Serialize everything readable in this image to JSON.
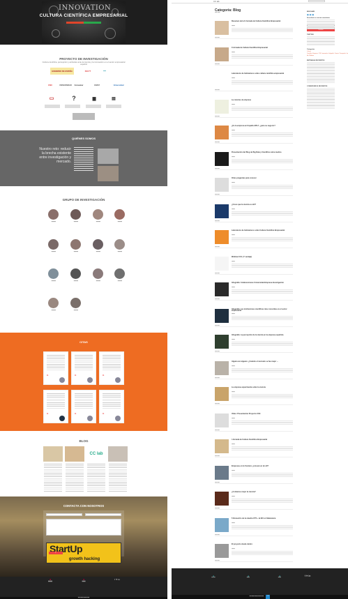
{
  "left": {
    "hero": {
      "title": "CULTURA CIENTÍFICA EMPRESARIAL",
      "innovation_word": "INNOVATION"
    },
    "project": {
      "title": "PROYECTO DE INVESTIGACIÓN",
      "subtitle": "Cultura científica, percepción y actitudes ante la ciencia y la innovación en el sector empresarial español",
      "logos": [
        "GOBIERNO DE ESPAÑA",
        "FECYT",
        "CSIC",
        "UNIVERSIDAD",
        "Consumer",
        "ICMAT",
        "Universidad"
      ],
      "icons": [
        "book-icon",
        "question-icon",
        "group-icon",
        "chart-icon"
      ]
    },
    "quienes": {
      "title": "QUIÉNES SOMOS",
      "quote": "Nuestro reto: reducir la brecha existente entre investigación y mercado."
    },
    "grupo": {
      "title": "GRUPO DE INVESTIGACIÓN"
    },
    "citas": {
      "title": "CITAS"
    },
    "blog": {
      "title": "BLOG",
      "cc_logo": "CC lab"
    },
    "contact": {
      "title": "CONTACTA CON NOSOTROS",
      "startup_word": "StartUp",
      "growth_word": "growth hacking"
    },
    "footer": {
      "social": "f ✈ in"
    }
  },
  "right": {
    "topnav": {
      "logo": "CC lab"
    },
    "category_title": "Categoría: Blog",
    "posts": [
      {
        "title": "Resumen de la II Jornada de Cultura Científica Empresarial"
      },
      {
        "title": "II Jornada de Cultura Científica Empresarial"
      },
      {
        "title": "Laboratorio de Indicadores sobre cultura científica empresarial"
      },
      {
        "title": "La ciencia a la empresa"
      },
      {
        "title": "¿Es la empresa en España APIs?, ¿para su negocio?"
      },
      {
        "title": "Presentación del Blog de Big Data y Científica sobre medios"
      },
      {
        "title": "Otras preguntas para conocer"
      },
      {
        "title": "¿Crees que la ciencia es útil?"
      },
      {
        "title": "Laboratorio de Indicadores sobre Cultura Científica Empresarial"
      },
      {
        "title": "Webinar CCL (Y ventaja)"
      },
      {
        "title": "Infografía: Colaboraciones Universidad-Empresa-Investigación"
      },
      {
        "title": "Infografía: Las instituciones científicas más conocidas en el sector empresarial"
      },
      {
        "title": "Infografía: La percepción de la ciencia en la empresa española"
      },
      {
        "title": "Alguna vez alguien. ¿Cuándo el mercado se fue mejor ..."
      },
      {
        "title": "La empresa experimenta sobre la ciencia"
      },
      {
        "title": "Vídeo: Presentación Proyecto CCE"
      },
      {
        "title": "I Jornada de Cultura Científica Empresarial"
      },
      {
        "title": "Empresas en la frontera: ¿innovar en la I+D?"
      },
      {
        "title": "¿Contamos mejor la ciencia?"
      },
      {
        "title": "5 Encuentro de la catedra CTS + la ECI en Salamanca"
      },
      {
        "title": "El proyecto desde dentro"
      }
    ],
    "sidebar": {
      "blog_label": "BÚSCAME",
      "subscribe_label": "Suscríbete a nuestra newsletter",
      "subscribe_button": "Suscríbete",
      "twitter_label": "TWITTER",
      "cats_label": "Categorías",
      "tags": [
        "Cultura Científica",
        "Empresa",
        "CCE",
        "Innovación",
        "Infografía",
        "Ciencia",
        "Percepción",
        "Investigación",
        "Empresa",
        "Cultura",
        "CCE lab",
        "Webinar"
      ],
      "recent_label": "ENTRADAS RECIENTES",
      "comments_label": "COMENTARIOS RECIENTES"
    },
    "footer": {
      "social": "f ✈ in",
      "cookie_ok": "OK"
    }
  }
}
